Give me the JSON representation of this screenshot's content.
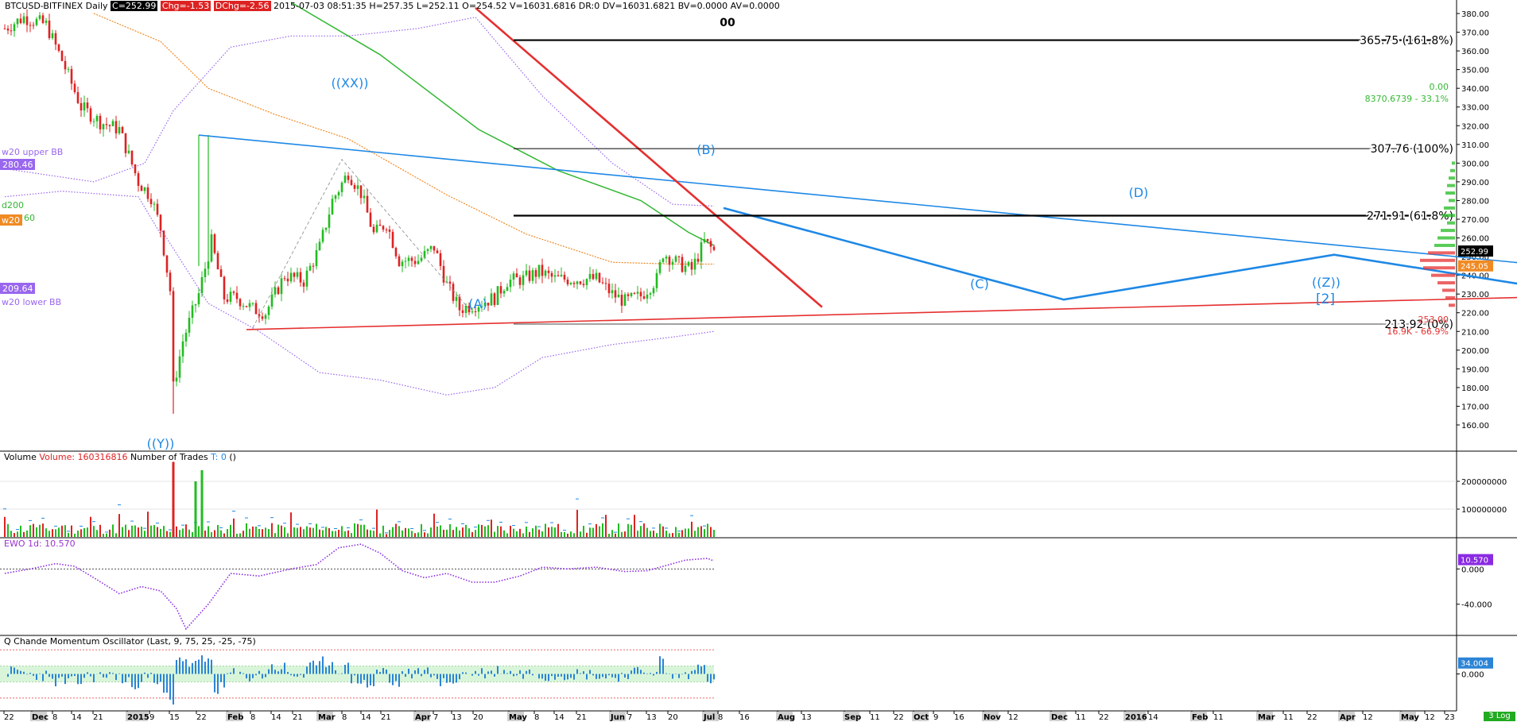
{
  "header": {
    "symbol": "BTCUSD-BITFINEX Daily",
    "close": "C=252.99",
    "chg": "Chg=-1.53",
    "dchg": "DChg=-2.56",
    "rest": "2015-07-03 08:51:35  H=257.35  L=252.11  O=254.52  V=16031.6816  DR:0  DV=16031.6821  BV=0.0000  AV=0.0000"
  },
  "colors": {
    "up": "#22bb22",
    "down": "#dd2222",
    "sma200": "#33b833",
    "ema20": "#f08a24",
    "bb": "#9966ee",
    "fibo": "#000000",
    "wave": "#1e88e5",
    "redline": "#e53030"
  },
  "chart_data": [
    {
      "type": "candlestick",
      "title": "BTCUSD-BITFINEX Daily",
      "ylim": [
        150,
        385
      ],
      "y_ticks": [
        "380.00",
        "370.00",
        "360.00",
        "350.00",
        "340.00",
        "330.00",
        "320.00",
        "310.00",
        "300.00",
        "290.00",
        "280.00",
        "270.00",
        "260.00",
        "250.00",
        "240.00",
        "230.00",
        "220.00",
        "210.00",
        "200.00",
        "190.00",
        "180.00",
        "170.00",
        "160.00"
      ],
      "x_ticks": [
        "22",
        "Dec",
        "8",
        "14",
        "21",
        "2015",
        "9",
        "15",
        "22",
        "Feb",
        "8",
        "14",
        "21",
        "Mar",
        "8",
        "14",
        "21",
        "Apr",
        "7",
        "13",
        "20",
        "May",
        "8",
        "14",
        "21",
        "Jun",
        "7",
        "13",
        "20",
        "Jul",
        "8",
        "16",
        "Aug",
        "13",
        "Sep",
        "11",
        "22",
        "Oct",
        "9",
        "16",
        "Nov",
        "12",
        "Dec",
        "11",
        "22",
        "2016",
        "14",
        "Feb",
        "11",
        "Mar",
        "11",
        "22",
        "Apr",
        "12",
        "May",
        "12",
        "23"
      ],
      "close_path": [
        [
          "2014-11-22",
          372
        ],
        [
          "2014-11-28",
          378
        ],
        [
          "2014-12-05",
          374
        ],
        [
          "2014-12-10",
          355
        ],
        [
          "2014-12-16",
          330
        ],
        [
          "2014-12-22",
          322
        ],
        [
          "2014-12-28",
          318
        ],
        [
          "2015-01-03",
          290
        ],
        [
          "2015-01-07",
          282
        ],
        [
          "2015-01-10",
          265
        ],
        [
          "2015-01-13",
          232
        ],
        [
          "2015-01-14",
          180
        ],
        [
          "2015-01-17",
          205
        ],
        [
          "2015-01-22",
          230
        ],
        [
          "2015-01-26",
          258
        ],
        [
          "2015-01-30",
          228
        ],
        [
          "2015-02-03",
          228
        ],
        [
          "2015-02-08",
          222
        ],
        [
          "2015-02-12",
          220
        ],
        [
          "2015-02-18",
          240
        ],
        [
          "2015-02-24",
          237
        ],
        [
          "2015-03-01",
          255
        ],
        [
          "2015-03-05",
          280
        ],
        [
          "2015-03-10",
          295
        ],
        [
          "2015-03-14",
          284
        ],
        [
          "2015-03-18",
          262
        ],
        [
          "2015-03-22",
          268
        ],
        [
          "2015-03-26",
          248
        ],
        [
          "2015-04-01",
          248
        ],
        [
          "2015-04-06",
          255
        ],
        [
          "2015-04-10",
          235
        ],
        [
          "2015-04-14",
          222
        ],
        [
          "2015-04-20",
          225
        ],
        [
          "2015-04-25",
          228
        ],
        [
          "2015-04-29",
          237
        ],
        [
          "2015-05-04",
          238
        ],
        [
          "2015-05-09",
          242
        ],
        [
          "2015-05-14",
          238
        ],
        [
          "2015-05-20",
          238
        ],
        [
          "2015-05-27",
          238
        ],
        [
          "2015-06-01",
          230
        ],
        [
          "2015-06-05",
          226
        ],
        [
          "2015-06-10",
          229
        ],
        [
          "2015-06-15",
          238
        ],
        [
          "2015-06-17",
          252
        ],
        [
          "2015-06-22",
          246
        ],
        [
          "2015-06-26",
          243
        ],
        [
          "2015-06-30",
          258
        ],
        [
          "2015-07-03",
          253
        ]
      ],
      "candle_low": {
        "date": "2015-01-14",
        "value": 166
      },
      "candle_high": {
        "date": "2015-03-10",
        "value": 302
      },
      "price_markers": {
        "close": "252.99",
        "ema20": "245.05",
        "bb_upper": "280.46",
        "bb_lower": "209.64"
      },
      "indicator_labels": {
        "bb_upper": "w20 upper BB",
        "bb_lower": "w20 lower BB",
        "sma200": "d200",
        "ema20": "w20",
        "ema20_value": "60"
      },
      "fib_levels": [
        {
          "value": 365.75,
          "label": "365.75  (161.8%)"
        },
        {
          "value": 307.76,
          "label": "307.76  (100%)"
        },
        {
          "value": 271.91,
          "label": "271.91  (61.8%)"
        },
        {
          "value": 213.92,
          "label": "213.92  (0%)"
        }
      ],
      "fib_top_label": "00",
      "wave_labels": [
        "((XX))",
        "(B)",
        "(A)",
        "(C)",
        "(D)",
        "((Z))",
        "[2]",
        "((Y))"
      ],
      "projection": [
        [
          "2015-07-06",
          276
        ],
        [
          "2015-10-21",
          227
        ],
        [
          "2016-01-14",
          251
        ],
        [
          "2016-03-25",
          232
        ]
      ],
      "triangle_top": [
        [
          "2015-01-22",
          315
        ],
        [
          "2016-04-22",
          240
        ]
      ],
      "triangle_bottom": [
        [
          "2015-02-06",
          211
        ],
        [
          "2016-04-01",
          229
        ]
      ],
      "downtrend": [
        [
          "2015-04-19",
          383
        ],
        [
          "2015-08-06",
          223
        ]
      ],
      "volume_profile": {
        "top": "0.00",
        "top2": "8370.6739 - 33.1%",
        "bottom": "253.00",
        "bottom2": "16.9K - 66.9%"
      }
    },
    {
      "type": "bar",
      "title": "Volume",
      "series_label": "Volume: 160316816",
      "extra": "Number of Trades",
      "trades": "T: 0",
      "paren": "()",
      "y_ticks": [
        "200000000",
        "100000000"
      ],
      "ylim": [
        0,
        280000000
      ],
      "spikes": [
        [
          "2015-01-14",
          270000000
        ],
        [
          "2015-01-23",
          240000000
        ],
        [
          "2015-01-21",
          200000000
        ]
      ]
    },
    {
      "type": "line",
      "title": "EWO 1d: 10.570",
      "last": "10.570",
      "y_ticks": [
        "0.000",
        "-40.000"
      ],
      "ylim": [
        -70,
        30
      ],
      "values": [
        [
          -5,
          "2014-11-22"
        ],
        [
          0,
          "2014-11-30"
        ],
        [
          6,
          "2014-12-08"
        ],
        [
          3,
          "2014-12-14"
        ],
        [
          -10,
          "2014-12-20"
        ],
        [
          -28,
          "2014-12-28"
        ],
        [
          -20,
          "2015-01-04"
        ],
        [
          -25,
          "2015-01-10"
        ],
        [
          -45,
          "2015-01-15"
        ],
        [
          -68,
          "2015-01-18"
        ],
        [
          -40,
          "2015-01-25"
        ],
        [
          -5,
          "2015-02-01"
        ],
        [
          -8,
          "2015-02-10"
        ],
        [
          0,
          "2015-02-20"
        ],
        [
          5,
          "2015-02-28"
        ],
        [
          24,
          "2015-03-07"
        ],
        [
          28,
          "2015-03-14"
        ],
        [
          18,
          "2015-03-20"
        ],
        [
          -2,
          "2015-03-27"
        ],
        [
          -10,
          "2015-04-03"
        ],
        [
          -5,
          "2015-04-10"
        ],
        [
          -15,
          "2015-04-18"
        ],
        [
          -15,
          "2015-04-25"
        ],
        [
          -8,
          "2015-05-03"
        ],
        [
          2,
          "2015-05-10"
        ],
        [
          0,
          "2015-05-18"
        ],
        [
          2,
          "2015-05-27"
        ],
        [
          -3,
          "2015-06-05"
        ],
        [
          -2,
          "2015-06-12"
        ],
        [
          4,
          "2015-06-18"
        ],
        [
          10,
          "2015-06-24"
        ],
        [
          12,
          "2015-07-01"
        ],
        [
          9,
          "2015-07-03"
        ]
      ]
    },
    {
      "type": "bar",
      "title": "Q Chande Momentum Oscillator  (Last, 9, 75, 25, -25, -75)",
      "last": "34.004",
      "y_ticks": [
        "0.000"
      ],
      "ylim": [
        -100,
        100
      ],
      "bands": [
        75,
        25,
        -25,
        -75
      ]
    }
  ],
  "status": {
    "scale_button": "3 Log"
  }
}
